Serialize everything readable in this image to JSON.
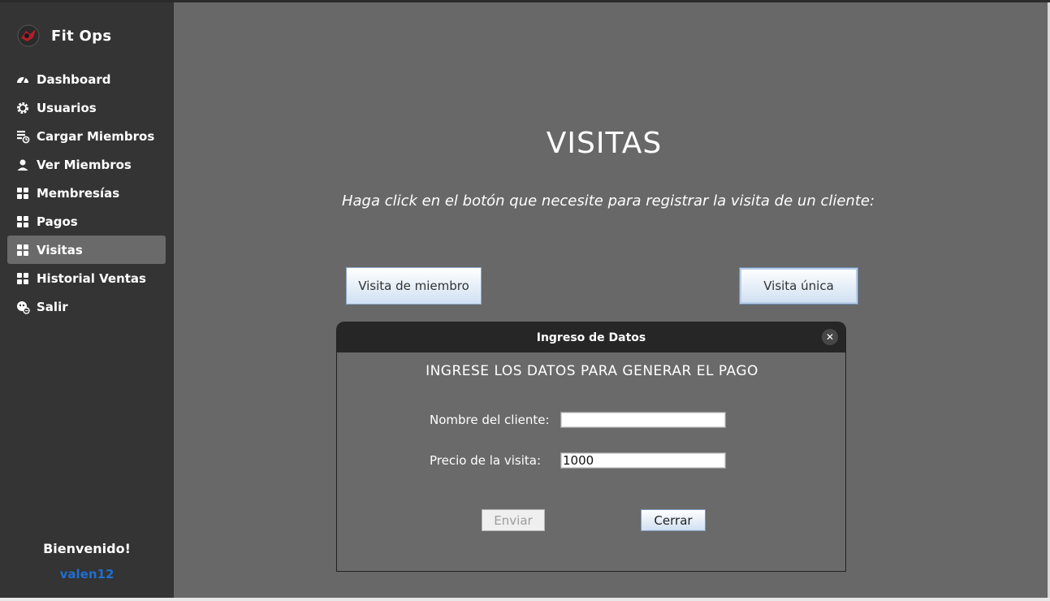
{
  "app": {
    "name": "Fit Ops"
  },
  "sidebar": {
    "items": [
      {
        "label": "Dashboard",
        "icon": "dashboard-icon"
      },
      {
        "label": "Usuarios",
        "icon": "gear-icon"
      },
      {
        "label": "Cargar Miembros",
        "icon": "add-member-icon"
      },
      {
        "label": "Ver Miembros",
        "icon": "person-icon"
      },
      {
        "label": "Membresías",
        "icon": "grid-icon"
      },
      {
        "label": "Pagos",
        "icon": "grid-icon"
      },
      {
        "label": "Visitas",
        "icon": "grid-icon",
        "active": true
      },
      {
        "label": "Historial Ventas",
        "icon": "grid-icon"
      },
      {
        "label": "Salir",
        "icon": "logout-icon"
      }
    ],
    "welcome": "Bienvenido!",
    "username": "valen12"
  },
  "main": {
    "title": "VISITAS",
    "instructions": "Haga click en el botón que necesite para registrar la visita de un cliente:",
    "member_visit_button": "Visita de miembro",
    "single_visit_button": "Visita única"
  },
  "dialog": {
    "title": "Ingreso de Datos",
    "heading": "INGRESE LOS DATOS PARA GENERAR EL PAGO",
    "client_name_label": "Nombre del cliente:",
    "client_name_value": "",
    "price_label": "Precio de la visita:",
    "price_value": "1000",
    "send_button": "Enviar",
    "close_button": "Cerrar"
  },
  "colors": {
    "sidebar_bg": "#343434",
    "main_bg": "#686868",
    "active_item_bg": "#6a6a6a",
    "username_color": "#1f6fd1",
    "dialog_titlebar": "#262626"
  }
}
